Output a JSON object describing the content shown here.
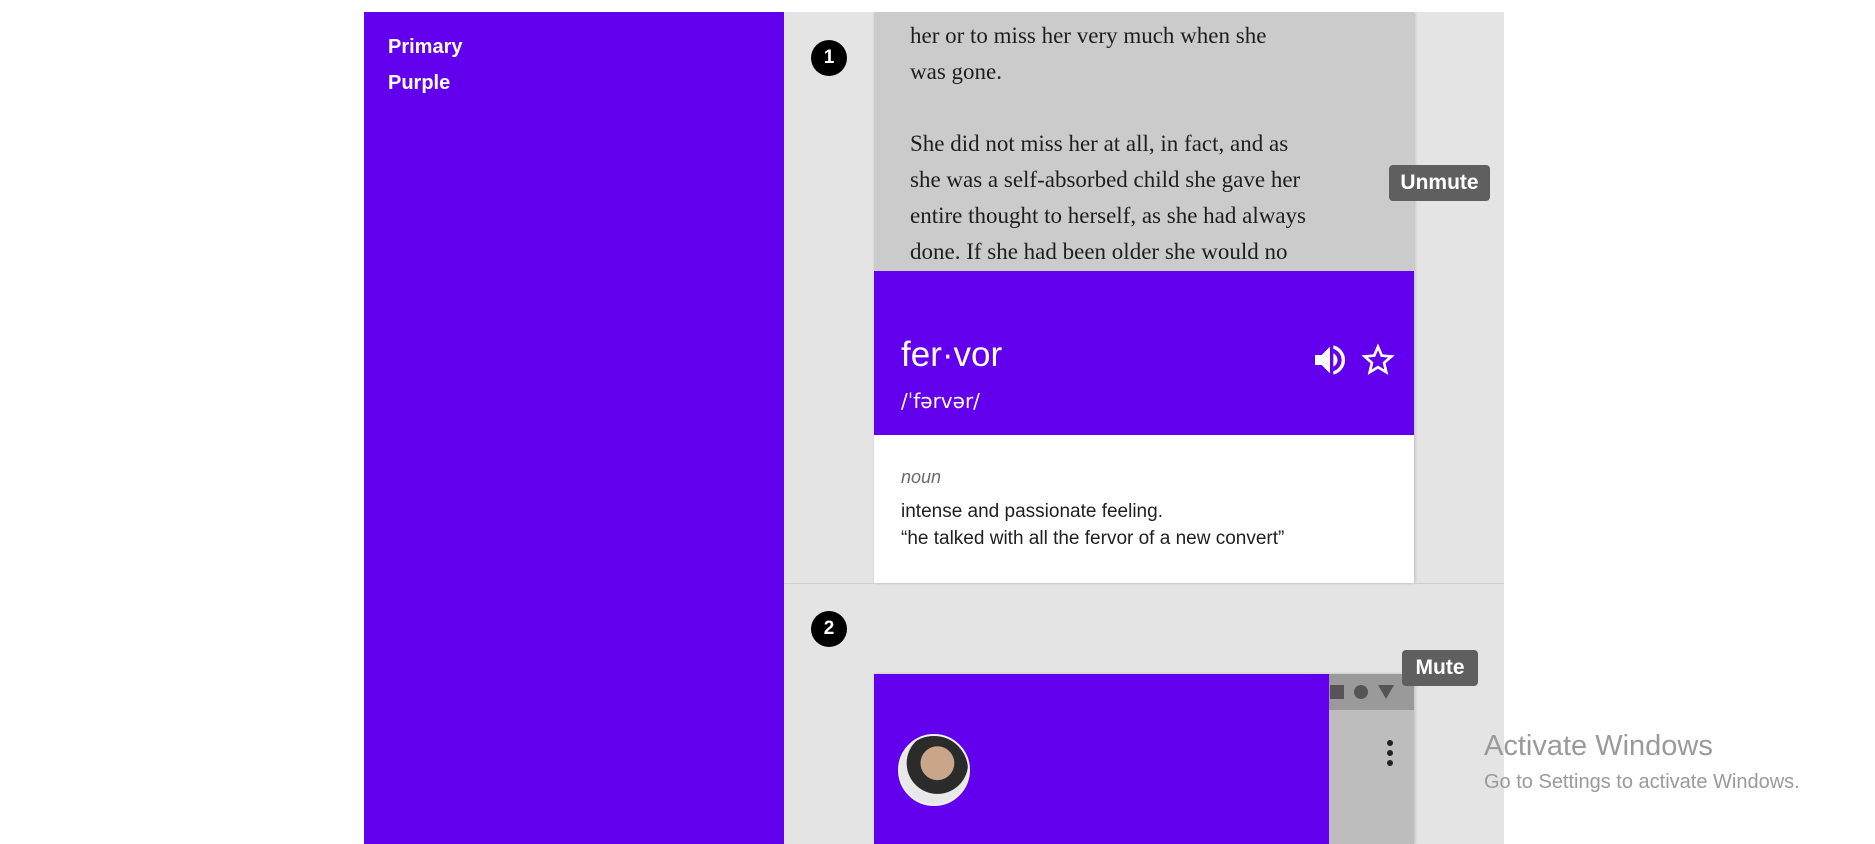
{
  "swatch": {
    "line1": "Primary",
    "line2": "Purple",
    "color": "#6200ee"
  },
  "steps": {
    "first": "1",
    "second": "2"
  },
  "book": {
    "lines": [
      "her or to miss her very much when she",
      "was gone.",
      "",
      "She did not miss her at all, in fact, and as",
      "she was a self-absorbed child she gave her",
      "entire thought to herself, as she had always",
      "done. If she had been older she would no"
    ]
  },
  "definition": {
    "word": "fer·vor",
    "pronunciation": "/ˈfərvər/",
    "part_of_speech": "noun",
    "meaning": "intense and passionate feeling.",
    "example": "“he talked with all the fervor of a new convert”",
    "icons": [
      "volume-icon",
      "star-icon"
    ]
  },
  "tooltips": {
    "unmute": "Unmute",
    "mute": "Mute"
  },
  "phone": {
    "icons": [
      "square-icon",
      "circle-icon",
      "triangle-icon",
      "more-vert-icon"
    ]
  },
  "watermark": {
    "title": "Activate Windows",
    "subtitle": "Go to Settings to activate Windows."
  }
}
